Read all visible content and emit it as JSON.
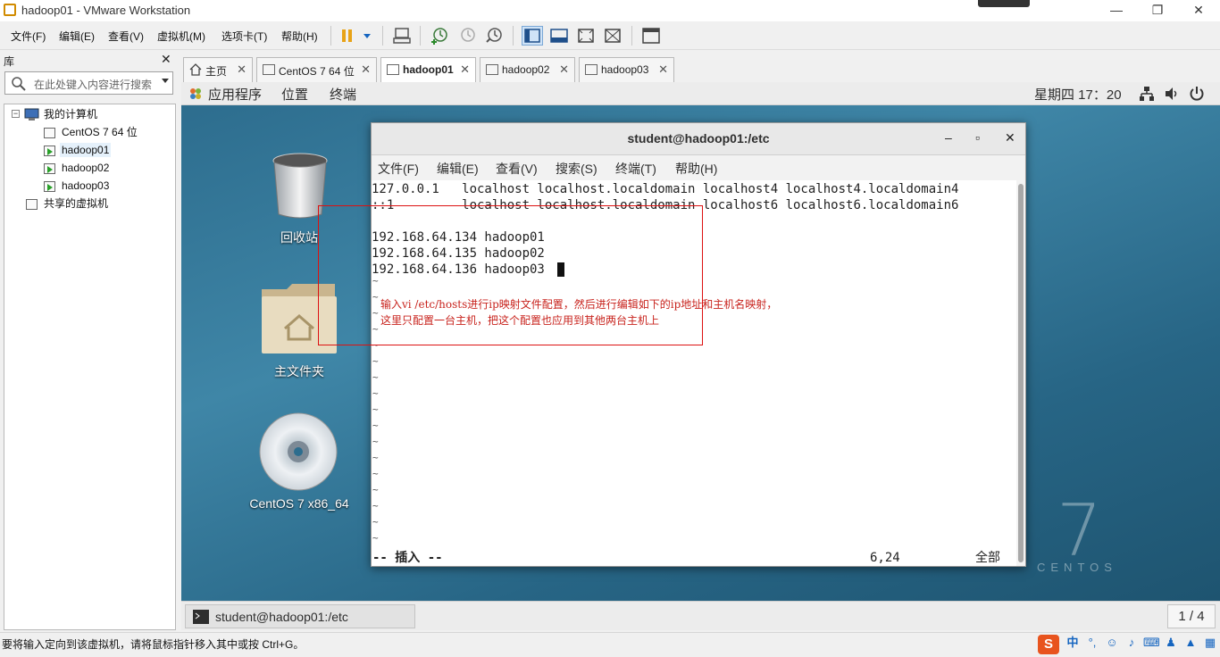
{
  "window": {
    "title": "hadoop01 - VMware Workstation",
    "minimize": "—",
    "restore": "❐",
    "close": "✕"
  },
  "menu": [
    "文件(F)",
    "编辑(E)",
    "查看(V)",
    "虚拟机(M)",
    "选项卡(T)",
    "帮助(H)"
  ],
  "library": {
    "title": "库",
    "close": "✕",
    "search_placeholder": "在此处键入内容进行搜索",
    "tree": {
      "root": "我的计算机",
      "vms": [
        "CentOS 7 64 位",
        "hadoop01",
        "hadoop02",
        "hadoop03"
      ],
      "shared": "共享的虚拟机"
    }
  },
  "tabs": [
    {
      "label": "主页",
      "close": "✕"
    },
    {
      "label": "CentOS 7 64 位",
      "close": "✕"
    },
    {
      "label": "hadoop01",
      "close": "✕"
    },
    {
      "label": "hadoop02",
      "close": "✕"
    },
    {
      "label": "hadoop03",
      "close": "✕"
    }
  ],
  "guest_bar": {
    "apps": "应用程序",
    "places": "位置",
    "terminal": "终端",
    "clock": "星期四 17：20"
  },
  "desktop": {
    "trash": "回收站",
    "home": "主文件夹",
    "disc": "CentOS 7 x86_64",
    "centos_logo_num": "7",
    "centos_logo_word": "CENTOS"
  },
  "terminal": {
    "title": "student@hadoop01:/etc",
    "min": "‒",
    "max": "▫",
    "close": "✕",
    "menu": [
      "文件(F)",
      "编辑(E)",
      "查看(V)",
      "搜索(S)",
      "终端(T)",
      "帮助(H)"
    ],
    "lines": [
      "127.0.0.1   localhost localhost.localdomain localhost4 localhost4.localdomain4",
      "::1         localhost localhost.localdomain localhost6 localhost6.localdomain6",
      "",
      "192.168.64.134 hadoop01",
      "192.168.64.135 hadoop02",
      "192.168.64.136 hadoop03"
    ],
    "tilde": "~",
    "mode": "-- 插入 --",
    "position": "6,24",
    "scope": "全部"
  },
  "annotation": {
    "line1": "输入vi /etc/hosts进行ip映射文件配置，然后进行编辑如下的ip地址和主机名映射，",
    "line2": "这里只配置一台主机，把这个配置也应用到其他两台主机上"
  },
  "guest_bottom": {
    "task": "student@hadoop01:/etc",
    "pager": "1 / 4"
  },
  "status": {
    "text": "要将输入定向到该虚拟机，请将鼠标指针移入其中或按 Ctrl+G。",
    "ime": "中"
  }
}
